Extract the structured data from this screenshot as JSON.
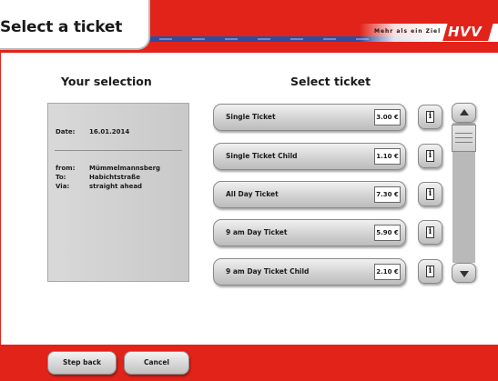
{
  "header": {
    "title": "Select a ticket",
    "slogan": "Mehr als ein Ziel",
    "logo_text": "HVV"
  },
  "selection": {
    "heading": "Your selection",
    "date_label": "Date:",
    "date_value": "16.01.2014",
    "from_label": "from:",
    "from_value": "Mümmelmannsberg",
    "to_label": "To:",
    "to_value": "Habichtstraße",
    "via_label": "Via:",
    "via_value": "straight ahead"
  },
  "tickets": {
    "heading": "Select ticket",
    "items": [
      {
        "name": "Single Ticket",
        "price": "3.00 €"
      },
      {
        "name": "Single Ticket Child",
        "price": "1.10 €"
      },
      {
        "name": "All Day Ticket",
        "price": "7.30 €"
      },
      {
        "name": "9 am Day Ticket",
        "price": "5.90 €"
      },
      {
        "name": "9 am Day Ticket Child",
        "price": "2.10 €"
      }
    ],
    "info_glyph": "i"
  },
  "footer": {
    "step_back_label": "Step back",
    "cancel_label": "Cancel"
  },
  "icons": {
    "info": "info-icon",
    "scroll_up": "chevron-up-icon",
    "scroll_down": "chevron-down-icon",
    "logo": "hvv-logo"
  },
  "colors": {
    "brand_red": "#e2231a",
    "stripe_blue": "#2f4ca0",
    "button_grey": "#d2d2d2",
    "panel_grey": "#cfcfcf"
  }
}
